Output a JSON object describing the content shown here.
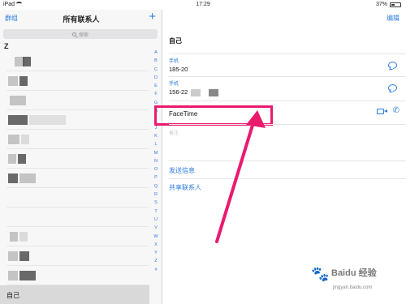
{
  "status_bar": {
    "device": "iPad",
    "time": "17:29",
    "battery": "37%"
  },
  "left_pane": {
    "groups_label": "群组",
    "title": "所有联系人",
    "add_label": "+",
    "search_placeholder": "搜索",
    "section_header": "Z",
    "index_letters": [
      "A",
      "B",
      "C",
      "D",
      "E",
      "F",
      "G",
      "H",
      "I",
      "J",
      "K",
      "L",
      "M",
      "N",
      "O",
      "P",
      "Q",
      "R",
      "S",
      "T",
      "U",
      "V",
      "W",
      "X",
      "Y",
      "Z",
      "#"
    ],
    "selected_contact": "自己"
  },
  "right_pane": {
    "edit_label": "编辑",
    "contact_name": "自己",
    "phones": [
      {
        "label": "手机",
        "value": "185-20"
      },
      {
        "label": "手机",
        "value": "156-22"
      }
    ],
    "facetime_label": "FaceTime",
    "notes_label": "备注",
    "send_message": "发送信息",
    "share_contact": "共享联系人"
  },
  "watermark": {
    "brand": "Baidu 经验",
    "url": "jingyan.baidu.com"
  },
  "colors": {
    "accent": "#2a7ae2",
    "highlight": "#ea1a6d"
  },
  "icons": [
    "search-icon",
    "add-icon",
    "message-icon",
    "video-icon",
    "phone-icon",
    "wifi-icon",
    "battery-icon"
  ]
}
